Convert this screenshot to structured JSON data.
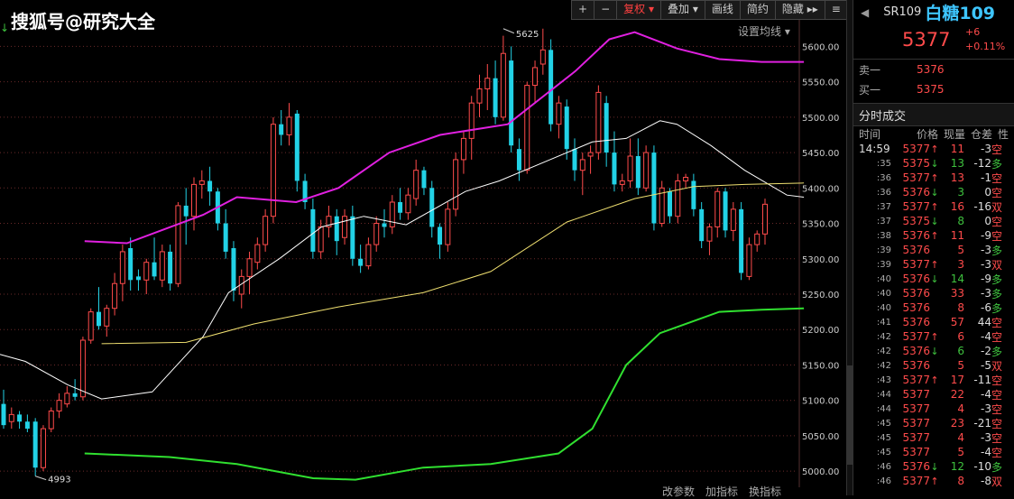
{
  "watermark": "搜狐号@研究大全",
  "toolbar": {
    "plus": "+",
    "minus": "−",
    "fuquan": "复权",
    "overlay": "叠加",
    "draw": "画线",
    "simple": "简约",
    "hide": "隐藏",
    "arrows": "▸▸",
    "menu": "≡"
  },
  "ma_settings": "设置均线",
  "bottom_links": [
    "改参数",
    "加指标",
    "换指标"
  ],
  "chart_data": {
    "type": "candlestick",
    "ylim": [
      4990,
      5640
    ],
    "yticks": [
      5000,
      5050,
      5100,
      5150,
      5200,
      5250,
      5300,
      5350,
      5400,
      5450,
      5500,
      5550,
      5600
    ],
    "ytick_labels": [
      "5000.00",
      "5050.00",
      "5100.00",
      "5150.00",
      "5200.00",
      "5250.00",
      "5300.00",
      "5350.00",
      "5400.00",
      "5450.00",
      "5500.00",
      "5550.00",
      "5600.00"
    ],
    "annotations": [
      {
        "label": "5625",
        "index": 63,
        "value": 5625
      },
      {
        "label": "4993",
        "index": 4,
        "value": 4993
      }
    ],
    "candles": [
      [
        5095,
        5115,
        5060,
        5065
      ],
      [
        5070,
        5090,
        5060,
        5080
      ],
      [
        5080,
        5085,
        5060,
        5070
      ],
      [
        5070,
        5080,
        5055,
        5060
      ],
      [
        5070,
        5075,
        4993,
        5005
      ],
      [
        5005,
        5065,
        5000,
        5060
      ],
      [
        5060,
        5090,
        5055,
        5085
      ],
      [
        5085,
        5110,
        5075,
        5100
      ],
      [
        5095,
        5120,
        5090,
        5110
      ],
      [
        5110,
        5130,
        5100,
        5105
      ],
      [
        5105,
        5190,
        5100,
        5185
      ],
      [
        5185,
        5230,
        5180,
        5225
      ],
      [
        5225,
        5260,
        5200,
        5205
      ],
      [
        5205,
        5235,
        5190,
        5230
      ],
      [
        5230,
        5280,
        5220,
        5265
      ],
      [
        5265,
        5320,
        5240,
        5310
      ],
      [
        5315,
        5330,
        5255,
        5270
      ],
      [
        5275,
        5285,
        5255,
        5270
      ],
      [
        5270,
        5300,
        5250,
        5295
      ],
      [
        5295,
        5330,
        5270,
        5275
      ],
      [
        5270,
        5320,
        5260,
        5310
      ],
      [
        5310,
        5320,
        5255,
        5265
      ],
      [
        5265,
        5380,
        5260,
        5375
      ],
      [
        5375,
        5400,
        5320,
        5360
      ],
      [
        5360,
        5415,
        5340,
        5405
      ],
      [
        5405,
        5425,
        5385,
        5410
      ],
      [
        5410,
        5430,
        5375,
        5395
      ],
      [
        5395,
        5400,
        5340,
        5350
      ],
      [
        5350,
        5370,
        5300,
        5310
      ],
      [
        5315,
        5325,
        5240,
        5255
      ],
      [
        5250,
        5285,
        5230,
        5275
      ],
      [
        5275,
        5310,
        5250,
        5300
      ],
      [
        5295,
        5330,
        5285,
        5320
      ],
      [
        5320,
        5370,
        5310,
        5360
      ],
      [
        5360,
        5500,
        5350,
        5490
      ],
      [
        5490,
        5510,
        5460,
        5475
      ],
      [
        5475,
        5520,
        5460,
        5500
      ],
      [
        5505,
        5510,
        5395,
        5410
      ],
      [
        5410,
        5420,
        5370,
        5380
      ],
      [
        5370,
        5385,
        5300,
        5310
      ],
      [
        5310,
        5355,
        5300,
        5345
      ],
      [
        5345,
        5375,
        5330,
        5360
      ],
      [
        5360,
        5370,
        5305,
        5325
      ],
      [
        5330,
        5370,
        5320,
        5360
      ],
      [
        5360,
        5375,
        5290,
        5300
      ],
      [
        5300,
        5320,
        5280,
        5290
      ],
      [
        5290,
        5330,
        5285,
        5320
      ],
      [
        5320,
        5360,
        5310,
        5350
      ],
      [
        5350,
        5370,
        5330,
        5345
      ],
      [
        5345,
        5390,
        5335,
        5380
      ],
      [
        5380,
        5400,
        5355,
        5365
      ],
      [
        5365,
        5400,
        5355,
        5390
      ],
      [
        5385,
        5440,
        5375,
        5425
      ],
      [
        5425,
        5430,
        5390,
        5400
      ],
      [
        5400,
        5410,
        5330,
        5345
      ],
      [
        5345,
        5350,
        5300,
        5320
      ],
      [
        5320,
        5380,
        5310,
        5370
      ],
      [
        5370,
        5450,
        5360,
        5440
      ],
      [
        5440,
        5480,
        5420,
        5470
      ],
      [
        5470,
        5530,
        5440,
        5520
      ],
      [
        5520,
        5560,
        5500,
        5540
      ],
      [
        5540,
        5575,
        5510,
        5555
      ],
      [
        5555,
        5580,
        5490,
        5500
      ],
      [
        5500,
        5615,
        5495,
        5590
      ],
      [
        5580,
        5600,
        5450,
        5460
      ],
      [
        5455,
        5470,
        5410,
        5425
      ],
      [
        5425,
        5550,
        5420,
        5545
      ],
      [
        5545,
        5580,
        5520,
        5570
      ],
      [
        5575,
        5625,
        5560,
        5595
      ],
      [
        5595,
        5610,
        5480,
        5490
      ],
      [
        5490,
        5530,
        5470,
        5520
      ],
      [
        5515,
        5525,
        5440,
        5455
      ],
      [
        5455,
        5470,
        5410,
        5425
      ],
      [
        5425,
        5450,
        5390,
        5440
      ],
      [
        5445,
        5460,
        5420,
        5450
      ],
      [
        5450,
        5545,
        5440,
        5535
      ],
      [
        5520,
        5530,
        5430,
        5450
      ],
      [
        5450,
        5480,
        5395,
        5405
      ],
      [
        5405,
        5420,
        5395,
        5410
      ],
      [
        5410,
        5470,
        5400,
        5445
      ],
      [
        5445,
        5470,
        5390,
        5400
      ],
      [
        5400,
        5460,
        5395,
        5450
      ],
      [
        5450,
        5460,
        5340,
        5350
      ],
      [
        5350,
        5410,
        5345,
        5400
      ],
      [
        5395,
        5400,
        5350,
        5360
      ],
      [
        5360,
        5420,
        5350,
        5410
      ],
      [
        5410,
        5420,
        5400,
        5415
      ],
      [
        5410,
        5420,
        5360,
        5370
      ],
      [
        5370,
        5380,
        5315,
        5325
      ],
      [
        5325,
        5350,
        5305,
        5345
      ],
      [
        5345,
        5400,
        5330,
        5395
      ],
      [
        5395,
        5400,
        5330,
        5340
      ],
      [
        5340,
        5380,
        5325,
        5370
      ],
      [
        5370,
        5380,
        5270,
        5280
      ],
      [
        5275,
        5330,
        5270,
        5320
      ],
      [
        5320,
        5340,
        5310,
        5335
      ],
      [
        5335,
        5385,
        5320,
        5377
      ]
    ],
    "series": [
      {
        "type": "line",
        "values": [
          [
            0,
            5165
          ],
          [
            0.03,
            5155
          ],
          [
            0.08,
            5122
          ],
          [
            0.12,
            5102
          ],
          [
            0.18,
            5112
          ],
          [
            0.24,
            5190
          ],
          [
            0.27,
            5252
          ],
          [
            0.33,
            5300
          ],
          [
            0.38,
            5345
          ],
          [
            0.43,
            5360
          ],
          [
            0.48,
            5348
          ],
          [
            0.55,
            5395
          ],
          [
            0.59,
            5410
          ],
          [
            0.65,
            5440
          ],
          [
            0.7,
            5465
          ],
          [
            0.74,
            5470
          ],
          [
            0.78,
            5495
          ],
          [
            0.8,
            5490
          ],
          [
            0.84,
            5460
          ],
          [
            0.88,
            5425
          ],
          [
            0.93,
            5390
          ],
          [
            0.95,
            5387
          ]
        ]
      },
      {
        "type": "line",
        "values": [
          [
            0.12,
            5180
          ],
          [
            0.22,
            5182
          ],
          [
            0.3,
            5208
          ],
          [
            0.4,
            5232
          ],
          [
            0.5,
            5252
          ],
          [
            0.58,
            5282
          ],
          [
            0.67,
            5352
          ],
          [
            0.75,
            5385
          ],
          [
            0.82,
            5402
          ],
          [
            0.88,
            5405
          ],
          [
            0.95,
            5407
          ]
        ]
      },
      {
        "type": "line",
        "values": [
          [
            0.1,
            5325
          ],
          [
            0.15,
            5322
          ],
          [
            0.24,
            5362
          ],
          [
            0.28,
            5387
          ],
          [
            0.35,
            5380
          ],
          [
            0.4,
            5400
          ],
          [
            0.46,
            5450
          ],
          [
            0.52,
            5475
          ],
          [
            0.6,
            5490
          ],
          [
            0.68,
            5565
          ],
          [
            0.72,
            5610
          ],
          [
            0.75,
            5620
          ],
          [
            0.8,
            5597
          ],
          [
            0.85,
            5582
          ],
          [
            0.9,
            5578
          ],
          [
            0.95,
            5578
          ]
        ]
      },
      {
        "type": "line",
        "values": [
          [
            0.1,
            5025
          ],
          [
            0.2,
            5020
          ],
          [
            0.28,
            5010
          ],
          [
            0.37,
            4990
          ],
          [
            0.42,
            4988
          ],
          [
            0.5,
            5005
          ],
          [
            0.58,
            5010
          ],
          [
            0.66,
            5025
          ],
          [
            0.7,
            5060
          ],
          [
            0.74,
            5150
          ],
          [
            0.78,
            5195
          ],
          [
            0.85,
            5225
          ],
          [
            0.9,
            5228
          ],
          [
            0.95,
            5230
          ]
        ]
      }
    ],
    "colors": {
      "up": "#ff4b4b",
      "down": "#22d2e6",
      "ma1": "#ffffff",
      "ma2": "#f0e070",
      "upper": "#e020e0",
      "lower": "#30e030",
      "grid": "#6a2a2a",
      "axis": "#cccccc"
    }
  },
  "panel": {
    "code": "SR109",
    "name": "白糖109",
    "price": "5377",
    "change": "+6",
    "change_pct": "+0.11%",
    "sell_label": "卖一",
    "sell_value": "5376",
    "buy_label": "买一",
    "buy_value": "5375",
    "section": "分时成交",
    "headers": [
      "时间",
      "价格",
      "现量",
      "仓差",
      "性"
    ],
    "trades": [
      {
        "t": "14:59",
        "p": "5377",
        "d": "up",
        "v": "11",
        "o": "-3",
        "k": "空"
      },
      {
        "t": ":35",
        "p": "5375",
        "d": "down",
        "v": "13",
        "o": "-12",
        "k": "多"
      },
      {
        "t": ":36",
        "p": "5377",
        "d": "up",
        "v": "13",
        "o": "-1",
        "k": "空"
      },
      {
        "t": ":36",
        "p": "5376",
        "d": "down",
        "v": "3",
        "o": "0",
        "k": "空"
      },
      {
        "t": ":37",
        "p": "5377",
        "d": "up",
        "v": "16",
        "o": "-16",
        "k": "双"
      },
      {
        "t": ":37",
        "p": "5375",
        "d": "down",
        "v": "8",
        "o": "0",
        "k": "空"
      },
      {
        "t": ":38",
        "p": "5376",
        "d": "up",
        "v": "11",
        "o": "-9",
        "k": "空"
      },
      {
        "t": ":39",
        "p": "5376",
        "d": "",
        "v": "5",
        "o": "-3",
        "k": "多"
      },
      {
        "t": ":39",
        "p": "5377",
        "d": "up",
        "v": "3",
        "o": "-3",
        "k": "双"
      },
      {
        "t": ":40",
        "p": "5376",
        "d": "down",
        "v": "14",
        "o": "-9",
        "k": "多"
      },
      {
        "t": ":40",
        "p": "5376",
        "d": "",
        "v": "33",
        "o": "-3",
        "k": "多"
      },
      {
        "t": ":40",
        "p": "5376",
        "d": "",
        "v": "8",
        "o": "-6",
        "k": "多"
      },
      {
        "t": ":41",
        "p": "5376",
        "d": "",
        "v": "57",
        "o": "44",
        "k": "空"
      },
      {
        "t": ":42",
        "p": "5377",
        "d": "up",
        "v": "6",
        "o": "-4",
        "k": "空"
      },
      {
        "t": ":42",
        "p": "5376",
        "d": "down",
        "v": "6",
        "o": "-2",
        "k": "多"
      },
      {
        "t": ":42",
        "p": "5376",
        "d": "",
        "v": "5",
        "o": "-5",
        "k": "双"
      },
      {
        "t": ":43",
        "p": "5377",
        "d": "up",
        "v": "17",
        "o": "-11",
        "k": "空"
      },
      {
        "t": ":44",
        "p": "5377",
        "d": "",
        "v": "22",
        "o": "-4",
        "k": "空"
      },
      {
        "t": ":44",
        "p": "5377",
        "d": "",
        "v": "4",
        "o": "-3",
        "k": "空"
      },
      {
        "t": ":45",
        "p": "5377",
        "d": "",
        "v": "23",
        "o": "-21",
        "k": "空"
      },
      {
        "t": ":45",
        "p": "5377",
        "d": "",
        "v": "4",
        "o": "-3",
        "k": "空"
      },
      {
        "t": ":45",
        "p": "5377",
        "d": "",
        "v": "5",
        "o": "-4",
        "k": "空"
      },
      {
        "t": ":46",
        "p": "5376",
        "d": "down",
        "v": "12",
        "o": "-10",
        "k": "多"
      },
      {
        "t": ":46",
        "p": "5377",
        "d": "up",
        "v": "8",
        "o": "-8",
        "k": "双"
      }
    ]
  }
}
